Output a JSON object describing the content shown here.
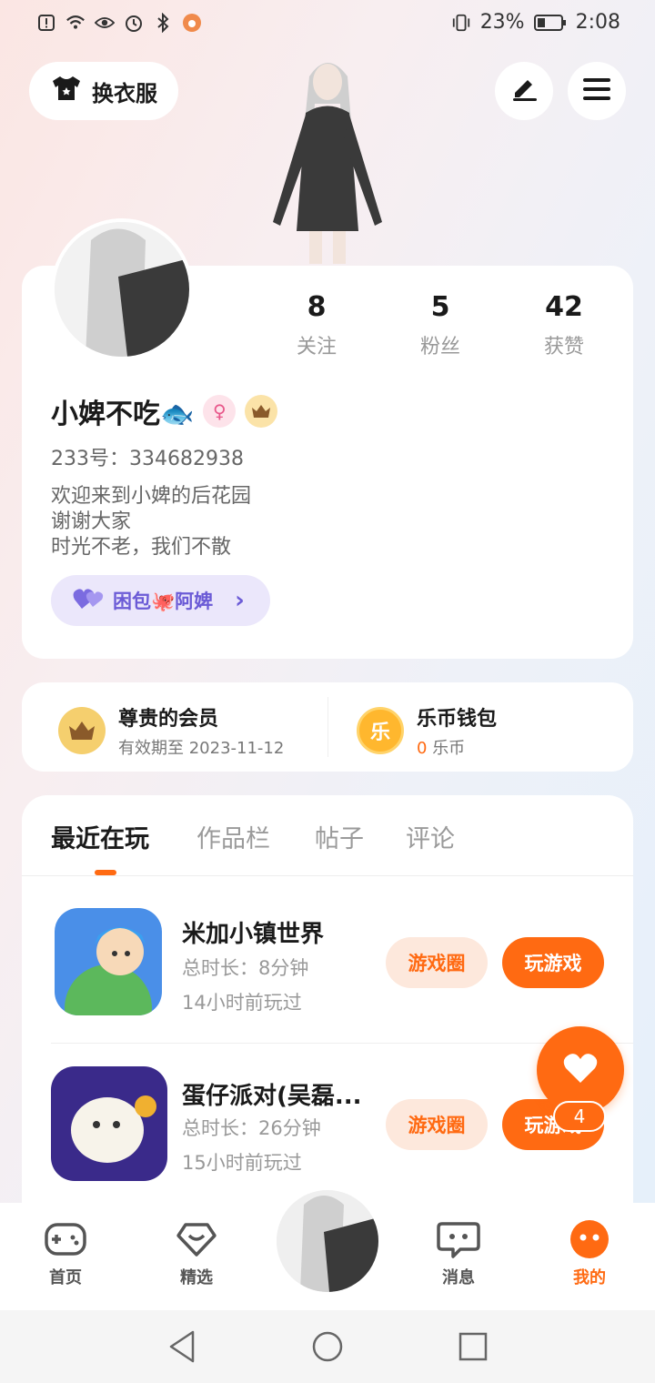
{
  "status_bar": {
    "battery_text": "23%",
    "time": "2:08",
    "icons": [
      "alert-icon",
      "wifi-icon",
      "eye-icon",
      "alarm-icon",
      "bluetooth-icon",
      "app-icon"
    ]
  },
  "top": {
    "wardrobe_label": "换衣服",
    "edit_icon": "edit-icon",
    "menu_icon": "menu-icon"
  },
  "profile": {
    "stats": [
      {
        "value": "8",
        "label": "关注"
      },
      {
        "value": "5",
        "label": "粉丝"
      },
      {
        "value": "42",
        "label": "获赞"
      }
    ],
    "name": "小婢不吃🐟",
    "gender_symbol": "♀",
    "uid_text": "233号：334682938",
    "bio": [
      "欢迎来到小婢的后花园",
      "谢谢大家",
      "时光不老，我们不散"
    ],
    "group": {
      "label": "困包🐙阿婢",
      "arrow": "›"
    }
  },
  "member": {
    "vip_title": "尊贵的会员",
    "vip_sub": "有效期至 2023-11-12",
    "wallet_title": "乐币钱包",
    "wallet_amount": "0",
    "wallet_unit": "乐币",
    "wallet_coin_char": "乐"
  },
  "tabs": [
    "最近在玩",
    "作品栏",
    "帖子",
    "评论"
  ],
  "games": [
    {
      "title": "米加小镇世界",
      "duration": "总时长：8分钟",
      "last_played": "14小时前玩过",
      "circle_label": "游戏圈",
      "play_label": "玩游戏"
    },
    {
      "title": "蛋仔派对(吴磊...",
      "duration": "总时长：26分钟",
      "last_played": "15小时前玩过",
      "circle_label": "游戏圈",
      "play_label": "玩游戏"
    }
  ],
  "fab": {
    "count": "4"
  },
  "bottom_nav": [
    {
      "label": "首页",
      "icon": "gamepad-icon"
    },
    {
      "label": "精选",
      "icon": "heart-badge-icon"
    },
    {
      "label": "消息",
      "icon": "chat-icon"
    },
    {
      "label": "我的",
      "icon": "profile-face-icon"
    }
  ],
  "colors": {
    "accent": "#ff6a12",
    "group_purple": "#6b5bd6"
  }
}
